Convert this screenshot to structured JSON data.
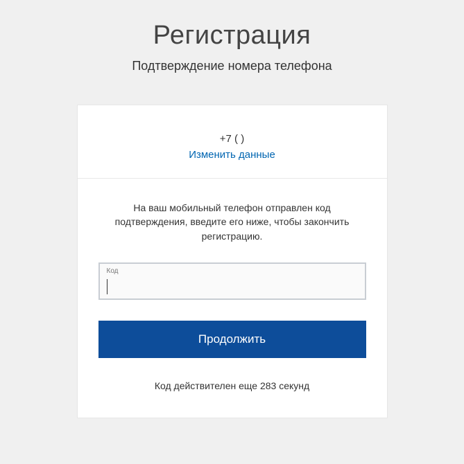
{
  "header": {
    "title": "Регистрация",
    "subtitle": "Подтверждение номера телефона"
  },
  "card": {
    "phone_display": "+7 (        )",
    "change_link": "Изменить данные",
    "instructions": "На ваш мобильный телефон отправлен код подтверждения, введите его ниже, чтобы закончить регистрацию.",
    "code_label": "Код",
    "code_value": "",
    "continue_label": "Продолжить",
    "countdown_text": "Код действителен еще 283 секунд"
  }
}
